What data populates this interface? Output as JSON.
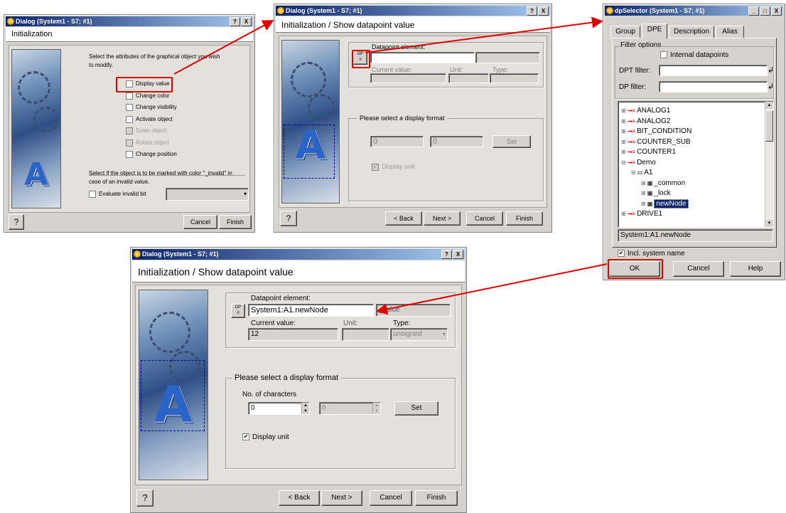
{
  "colors": {
    "accent_red": "#e00000",
    "title_bar": "#0a246a"
  },
  "dlg1": {
    "title": "Dialog (System1 - S7; #1)",
    "tbtns": [
      "?",
      "X"
    ],
    "header": "Initialization",
    "intro": "Select the attributes of the graphical object you wish to modify.",
    "options": [
      {
        "label": "Display value",
        "enabled": true
      },
      {
        "label": "Change color",
        "enabled": true
      },
      {
        "label": "Change visibility",
        "enabled": true
      },
      {
        "label": "Activate object",
        "enabled": true
      },
      {
        "label": "Scale object",
        "enabled": false
      },
      {
        "label": "Rotate object",
        "enabled": false
      },
      {
        "label": "Change position",
        "enabled": true
      }
    ],
    "invalid_text": "Select if the object is to be marked with color \"_invalid\" in case of an invalid value.",
    "evaluate_label": "Evaluate invalid bit",
    "help": "?",
    "cancel": "Cancel",
    "finish": "Finish"
  },
  "dlg2": {
    "title": "Dialog (System1 - S7; #1)",
    "tbtns": [
      "?",
      "X"
    ],
    "header": "Initialization / Show datapoint value",
    "dpe_label": "Datapoint element:",
    "current_label": "Current value:",
    "unit_label": "Unit:",
    "type_label": "Type:",
    "format_title": "Please select a display format",
    "spin1": "0",
    "spin2": "0",
    "set": "Set",
    "display_unit": "Display unit",
    "help": "?",
    "back": "< Back",
    "next": "Next >",
    "cancel": "Cancel",
    "finish": "Finish"
  },
  "dlg3": {
    "title": "dpSelector (System1 - S7; #1)",
    "tbtns": [
      "_",
      "□",
      "X"
    ],
    "tabs": [
      "Group",
      "DPE",
      "Description",
      "Alias"
    ],
    "filter_title": "Filter options",
    "internal_label": "Internal datapoints",
    "dpt_label": "DPT filter:",
    "dp_label": "DP filter:",
    "tree": [
      {
        "label": "ANALOG1",
        "indent": 0,
        "kind": "dp"
      },
      {
        "label": "ANALOG2",
        "indent": 0,
        "kind": "dp"
      },
      {
        "label": "BIT_CONDITION",
        "indent": 0,
        "kind": "dp"
      },
      {
        "label": "COUNTER_SUB",
        "indent": 0,
        "kind": "dp"
      },
      {
        "label": "COUNTER1",
        "indent": 0,
        "kind": "dp"
      },
      {
        "label": "Demo",
        "indent": 0,
        "kind": "dp"
      },
      {
        "label": "A1",
        "indent": 1,
        "kind": "folder"
      },
      {
        "label": "_common",
        "indent": 2,
        "kind": "el"
      },
      {
        "label": "_lock",
        "indent": 2,
        "kind": "el"
      },
      {
        "label": "newNode",
        "indent": 2,
        "kind": "sel"
      },
      {
        "label": "DRIVE1",
        "indent": 0,
        "kind": "dp"
      }
    ],
    "selected_path": "System1:A1.newNode",
    "incl_label": "Incl. system name",
    "ok": "OK",
    "cancel": "Cancel",
    "help": "Help"
  },
  "dlg4": {
    "title": "Dialog (System1 - S7; #1)",
    "tbtns": [
      "?",
      "X"
    ],
    "header": "Initialization / Show datapoint value",
    "dpe_label": "Datapoint element:",
    "dpe_value": "System1:A1.newNode",
    "dpe_aux": "_value",
    "current_label": "Current value:",
    "current_value": "12",
    "unit_label": "Unit:",
    "type_label": "Type:",
    "type_value": "unsigned",
    "format_title": "Please select a display format",
    "nochars_label": "No. of characters",
    "spin1": "0",
    "spin2": "0",
    "set": "Set",
    "display_unit": "Display unit",
    "help": "?",
    "back": "< Back",
    "next": "Next >",
    "cancel": "Cancel",
    "finish": "Finish"
  }
}
